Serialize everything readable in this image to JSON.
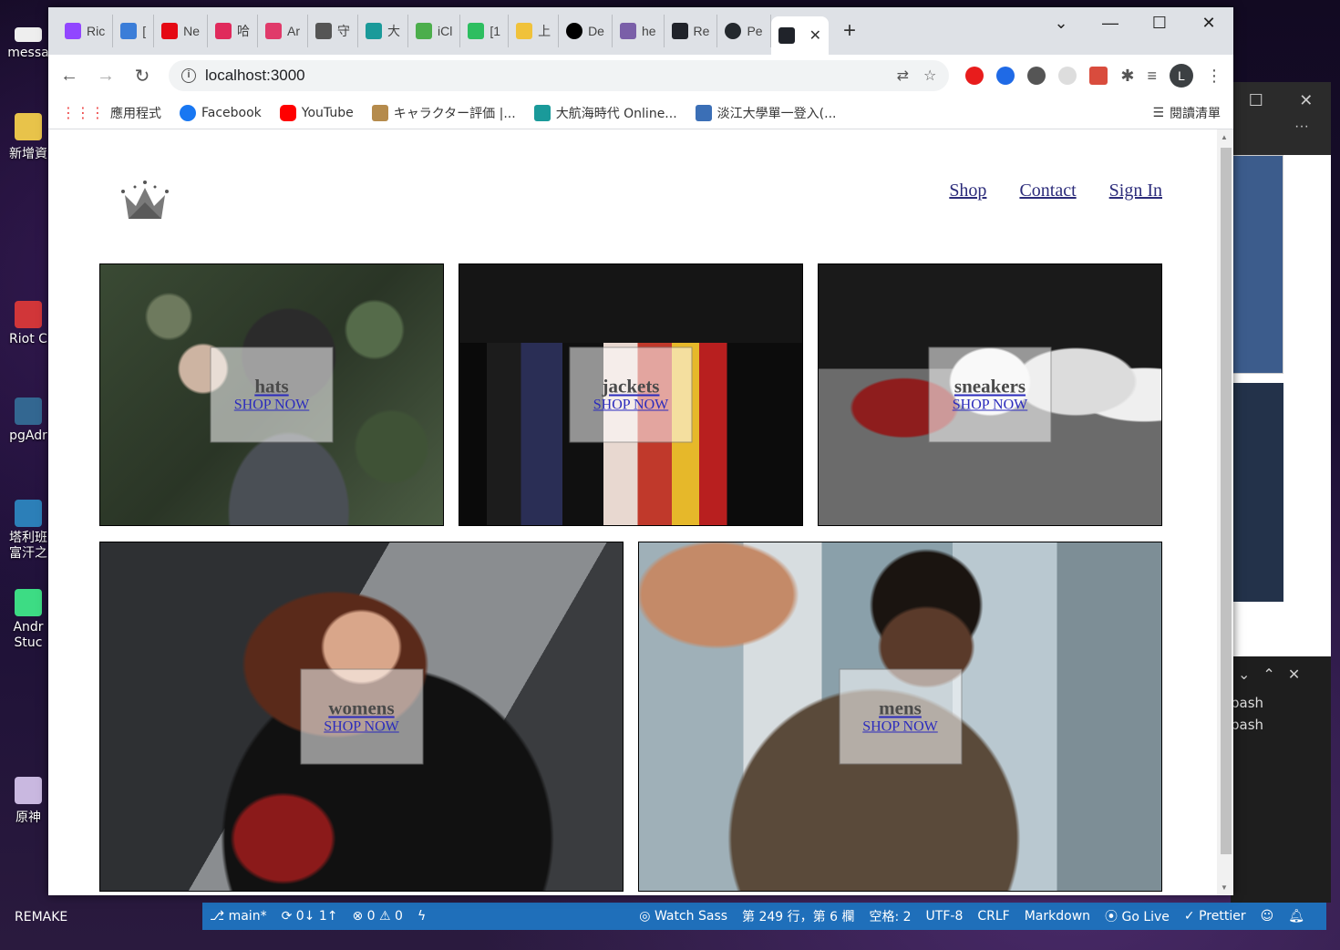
{
  "desktop": {
    "icons": [
      {
        "label": "messa"
      },
      {
        "label": "新增資"
      },
      {
        "label": "Riot C"
      },
      {
        "label": "pgAdr"
      },
      {
        "label": "塔利班富汗之"
      },
      {
        "label": "Andr Stuc"
      },
      {
        "label": "原神"
      },
      {
        "label": "REMAKE"
      }
    ]
  },
  "browser": {
    "tabs": [
      {
        "label": "Ric"
      },
      {
        "label": "["
      },
      {
        "label": "Ne"
      },
      {
        "label": "哈"
      },
      {
        "label": "Ar"
      },
      {
        "label": "守"
      },
      {
        "label": "大"
      },
      {
        "label": "iCl"
      },
      {
        "label": "[1"
      },
      {
        "label": "上"
      },
      {
        "label": "De"
      },
      {
        "label": "he"
      },
      {
        "label": "Re"
      },
      {
        "label": "Pe"
      }
    ],
    "active_tab_close": "✕",
    "new_tab": "+",
    "url": "localhost:3000",
    "avatar_letter": "L",
    "bookmarks": [
      {
        "label": "應用程式"
      },
      {
        "label": "Facebook"
      },
      {
        "label": "YouTube"
      },
      {
        "label": "キャラクター評価 |..."
      },
      {
        "label": "大航海時代 Online..."
      },
      {
        "label": "淡江大學單一登入(..."
      }
    ],
    "reading_list": "閱讀清單"
  },
  "site": {
    "nav": {
      "shop": "Shop",
      "contact": "Contact",
      "signin": "Sign In"
    },
    "menu": [
      {
        "title": "hats",
        "subtitle": "SHOP NOW"
      },
      {
        "title": "jackets",
        "subtitle": "SHOP NOW"
      },
      {
        "title": "sneakers",
        "subtitle": "SHOP NOW"
      },
      {
        "title": "womens",
        "subtitle": "SHOP NOW"
      },
      {
        "title": "mens",
        "subtitle": "SHOP NOW"
      }
    ]
  },
  "statusbar": {
    "branch": "main*",
    "sync": "0↓ 1↑",
    "problems": "⊗ 0 ⚠ 0",
    "watch_sass": "Watch Sass",
    "position": "第 249 行，第 6 欄",
    "spaces": "空格: 2",
    "encoding": "UTF-8",
    "eol": "CRLF",
    "language": "Markdown",
    "go_live": "Go Live",
    "prettier": "✓ Prettier"
  },
  "terminal": {
    "lines": [
      "bash",
      "bash"
    ]
  }
}
